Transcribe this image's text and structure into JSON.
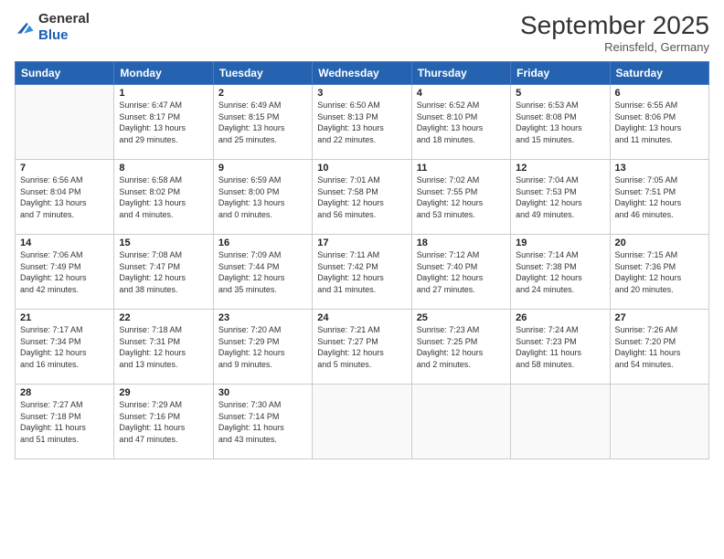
{
  "header": {
    "logo_general": "General",
    "logo_blue": "Blue",
    "month_title": "September 2025",
    "subtitle": "Reinsfeld, Germany"
  },
  "days_of_week": [
    "Sunday",
    "Monday",
    "Tuesday",
    "Wednesday",
    "Thursday",
    "Friday",
    "Saturday"
  ],
  "weeks": [
    [
      {
        "num": "",
        "info": ""
      },
      {
        "num": "1",
        "info": "Sunrise: 6:47 AM\nSunset: 8:17 PM\nDaylight: 13 hours\nand 29 minutes."
      },
      {
        "num": "2",
        "info": "Sunrise: 6:49 AM\nSunset: 8:15 PM\nDaylight: 13 hours\nand 25 minutes."
      },
      {
        "num": "3",
        "info": "Sunrise: 6:50 AM\nSunset: 8:13 PM\nDaylight: 13 hours\nand 22 minutes."
      },
      {
        "num": "4",
        "info": "Sunrise: 6:52 AM\nSunset: 8:10 PM\nDaylight: 13 hours\nand 18 minutes."
      },
      {
        "num": "5",
        "info": "Sunrise: 6:53 AM\nSunset: 8:08 PM\nDaylight: 13 hours\nand 15 minutes."
      },
      {
        "num": "6",
        "info": "Sunrise: 6:55 AM\nSunset: 8:06 PM\nDaylight: 13 hours\nand 11 minutes."
      }
    ],
    [
      {
        "num": "7",
        "info": "Sunrise: 6:56 AM\nSunset: 8:04 PM\nDaylight: 13 hours\nand 7 minutes."
      },
      {
        "num": "8",
        "info": "Sunrise: 6:58 AM\nSunset: 8:02 PM\nDaylight: 13 hours\nand 4 minutes."
      },
      {
        "num": "9",
        "info": "Sunrise: 6:59 AM\nSunset: 8:00 PM\nDaylight: 13 hours\nand 0 minutes."
      },
      {
        "num": "10",
        "info": "Sunrise: 7:01 AM\nSunset: 7:58 PM\nDaylight: 12 hours\nand 56 minutes."
      },
      {
        "num": "11",
        "info": "Sunrise: 7:02 AM\nSunset: 7:55 PM\nDaylight: 12 hours\nand 53 minutes."
      },
      {
        "num": "12",
        "info": "Sunrise: 7:04 AM\nSunset: 7:53 PM\nDaylight: 12 hours\nand 49 minutes."
      },
      {
        "num": "13",
        "info": "Sunrise: 7:05 AM\nSunset: 7:51 PM\nDaylight: 12 hours\nand 46 minutes."
      }
    ],
    [
      {
        "num": "14",
        "info": "Sunrise: 7:06 AM\nSunset: 7:49 PM\nDaylight: 12 hours\nand 42 minutes."
      },
      {
        "num": "15",
        "info": "Sunrise: 7:08 AM\nSunset: 7:47 PM\nDaylight: 12 hours\nand 38 minutes."
      },
      {
        "num": "16",
        "info": "Sunrise: 7:09 AM\nSunset: 7:44 PM\nDaylight: 12 hours\nand 35 minutes."
      },
      {
        "num": "17",
        "info": "Sunrise: 7:11 AM\nSunset: 7:42 PM\nDaylight: 12 hours\nand 31 minutes."
      },
      {
        "num": "18",
        "info": "Sunrise: 7:12 AM\nSunset: 7:40 PM\nDaylight: 12 hours\nand 27 minutes."
      },
      {
        "num": "19",
        "info": "Sunrise: 7:14 AM\nSunset: 7:38 PM\nDaylight: 12 hours\nand 24 minutes."
      },
      {
        "num": "20",
        "info": "Sunrise: 7:15 AM\nSunset: 7:36 PM\nDaylight: 12 hours\nand 20 minutes."
      }
    ],
    [
      {
        "num": "21",
        "info": "Sunrise: 7:17 AM\nSunset: 7:34 PM\nDaylight: 12 hours\nand 16 minutes."
      },
      {
        "num": "22",
        "info": "Sunrise: 7:18 AM\nSunset: 7:31 PM\nDaylight: 12 hours\nand 13 minutes."
      },
      {
        "num": "23",
        "info": "Sunrise: 7:20 AM\nSunset: 7:29 PM\nDaylight: 12 hours\nand 9 minutes."
      },
      {
        "num": "24",
        "info": "Sunrise: 7:21 AM\nSunset: 7:27 PM\nDaylight: 12 hours\nand 5 minutes."
      },
      {
        "num": "25",
        "info": "Sunrise: 7:23 AM\nSunset: 7:25 PM\nDaylight: 12 hours\nand 2 minutes."
      },
      {
        "num": "26",
        "info": "Sunrise: 7:24 AM\nSunset: 7:23 PM\nDaylight: 11 hours\nand 58 minutes."
      },
      {
        "num": "27",
        "info": "Sunrise: 7:26 AM\nSunset: 7:20 PM\nDaylight: 11 hours\nand 54 minutes."
      }
    ],
    [
      {
        "num": "28",
        "info": "Sunrise: 7:27 AM\nSunset: 7:18 PM\nDaylight: 11 hours\nand 51 minutes."
      },
      {
        "num": "29",
        "info": "Sunrise: 7:29 AM\nSunset: 7:16 PM\nDaylight: 11 hours\nand 47 minutes."
      },
      {
        "num": "30",
        "info": "Sunrise: 7:30 AM\nSunset: 7:14 PM\nDaylight: 11 hours\nand 43 minutes."
      },
      {
        "num": "",
        "info": ""
      },
      {
        "num": "",
        "info": ""
      },
      {
        "num": "",
        "info": ""
      },
      {
        "num": "",
        "info": ""
      }
    ]
  ]
}
